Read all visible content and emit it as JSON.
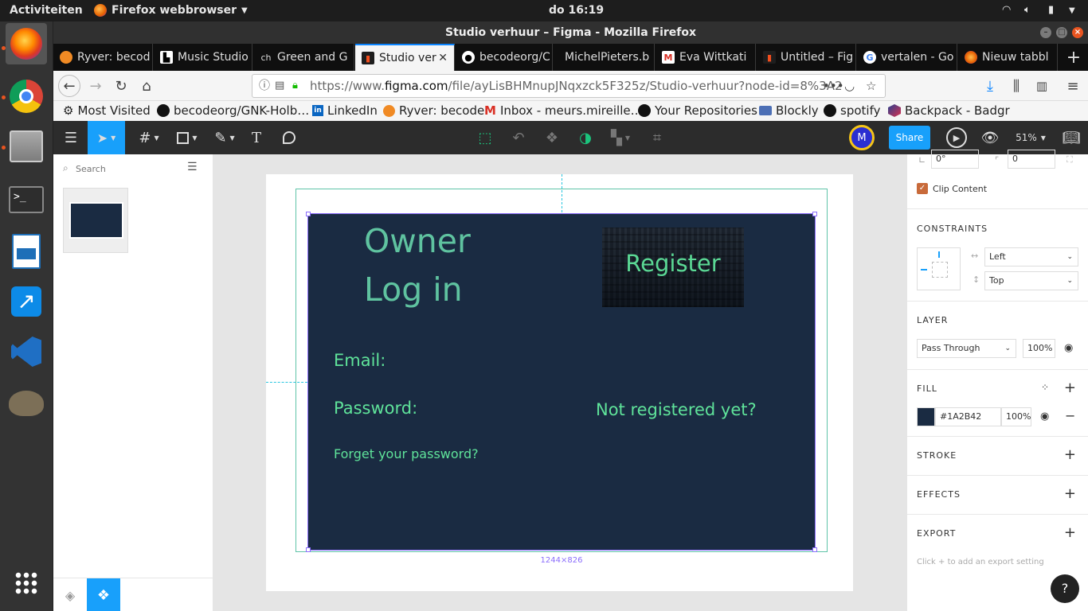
{
  "topbar": {
    "activities": "Activiteiten",
    "app": "Firefox webbrowser",
    "clock": "do 16:19"
  },
  "window": {
    "title": "Studio verhuur – Figma - Mozilla Firefox"
  },
  "tabs": [
    {
      "label": "Ryver: becod",
      "icon": "ryver"
    },
    {
      "label": "Music Studio",
      "icon": "studio"
    },
    {
      "label": "Green and G",
      "icon": "ch"
    },
    {
      "label": "Studio ver",
      "icon": "figma",
      "active": true
    },
    {
      "label": "becodeorg/C",
      "icon": "github"
    },
    {
      "label": "MichelPieters.b",
      "icon": "none"
    },
    {
      "label": "Eva Wittkati",
      "icon": "gmail"
    },
    {
      "label": "Untitled – Fig",
      "icon": "figma"
    },
    {
      "label": "vertalen - Go",
      "icon": "google"
    },
    {
      "label": "Nieuw tabbl",
      "icon": "firefox"
    }
  ],
  "nav": {
    "url_prefix": "https://www.",
    "url_domain": "figma.com",
    "url_rest": "/file/ayLisBHMnupJNqxzck5F325z/Studio-verhuur?node-id=8%3A2"
  },
  "bookmarks": [
    {
      "label": "Most Visited",
      "icon": "gear"
    },
    {
      "label": "becodeorg/GNK-Holb…",
      "icon": "github"
    },
    {
      "label": "LinkedIn",
      "icon": "linkedin"
    },
    {
      "label": "Ryver: becode",
      "icon": "ryver"
    },
    {
      "label": "Inbox - meurs.mireille…",
      "icon": "gmail"
    },
    {
      "label": "Your Repositories",
      "icon": "github"
    },
    {
      "label": "Blockly",
      "icon": "blockly"
    },
    {
      "label": "spotify",
      "icon": "spotify"
    },
    {
      "label": "Backpack - Badgr",
      "icon": "badgr"
    }
  ],
  "figma_toolbar": {
    "share": "Share",
    "zoom": "51%",
    "avatar": "M"
  },
  "left_panel": {
    "search_placeholder": "Search"
  },
  "frame": {
    "title_line1": "Owner",
    "title_line2": "Log in",
    "register": "Register",
    "email": "Email:",
    "password": "Password:",
    "forgot": "Forget your password?",
    "not_registered": "Not registered yet?",
    "dimensions": "1244×826",
    "bg": "#1A2B42",
    "text_color": "#5FE39A"
  },
  "right_panel": {
    "rotation": "0°",
    "radius": "0",
    "clip_content": "Clip Content",
    "constraints": {
      "header": "CONSTRAINTS",
      "horizontal": "Left",
      "vertical": "Top"
    },
    "layer": {
      "header": "LAYER",
      "blend": "Pass Through",
      "opacity": "100%"
    },
    "fill": {
      "header": "FILL",
      "hex": "#1A2B42",
      "opacity": "100%",
      "swatch": "#1A2B42"
    },
    "stroke": {
      "header": "STROKE"
    },
    "effects": {
      "header": "EFFECTS"
    },
    "export": {
      "header": "EXPORT",
      "hint": "Click + to add an export setting"
    },
    "help": "?"
  }
}
